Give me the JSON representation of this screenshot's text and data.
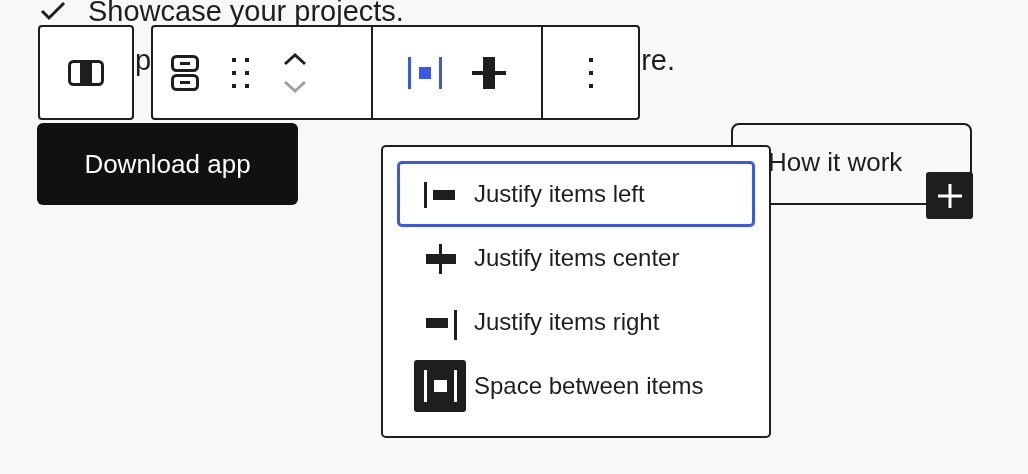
{
  "content": {
    "check_item": "Showcase your projects.",
    "hidden_line_fragments": [
      "p",
      "re."
    ]
  },
  "toolbar": {
    "groups": [
      {
        "items": [
          {
            "kind": "block",
            "pressed": false
          }
        ]
      },
      {
        "items": [
          {
            "kind": "stack",
            "pressed": false
          },
          {
            "kind": "drag",
            "pressed": false
          },
          {
            "kind": "mover",
            "pressed": false,
            "down_disabled": true
          }
        ]
      },
      {
        "items": [
          {
            "kind": "justify",
            "pressed": true
          },
          {
            "kind": "valign",
            "pressed": false
          }
        ]
      },
      {
        "items": [
          {
            "kind": "more",
            "pressed": false
          }
        ]
      }
    ]
  },
  "buttons": [
    {
      "label": "Download app",
      "kind": "primary"
    },
    {
      "label": "How it work",
      "kind": "outline"
    }
  ],
  "justify_menu": {
    "items": [
      {
        "label": "Justify items left",
        "kind": "left",
        "focused": true,
        "selected": false
      },
      {
        "label": "Justify items center",
        "kind": "center",
        "focused": false,
        "selected": false
      },
      {
        "label": "Justify items right",
        "kind": "right",
        "focused": false,
        "selected": false
      },
      {
        "label": "Space between items",
        "kind": "between",
        "focused": false,
        "selected": true
      }
    ]
  }
}
